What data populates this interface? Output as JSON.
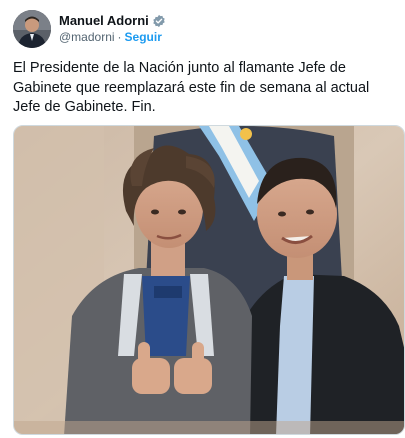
{
  "author": {
    "name": "Manuel Adorni",
    "handle": "@madorni",
    "separator": "·",
    "follow_label": "Seguir",
    "verified_icon": "verified-badge-icon",
    "avatar_icon": "avatar"
  },
  "tweet": {
    "text": "El Presidente de la Nación junto al flamante Jefe de Gabinete que reemplazará este fin de semana al actual Jefe de Gabinete. Fin."
  },
  "media": {
    "kind": "photo"
  },
  "colors": {
    "accent": "#1d9bf0",
    "text": "#0f1419",
    "secondary": "#536471",
    "border": "#cfd9de"
  }
}
